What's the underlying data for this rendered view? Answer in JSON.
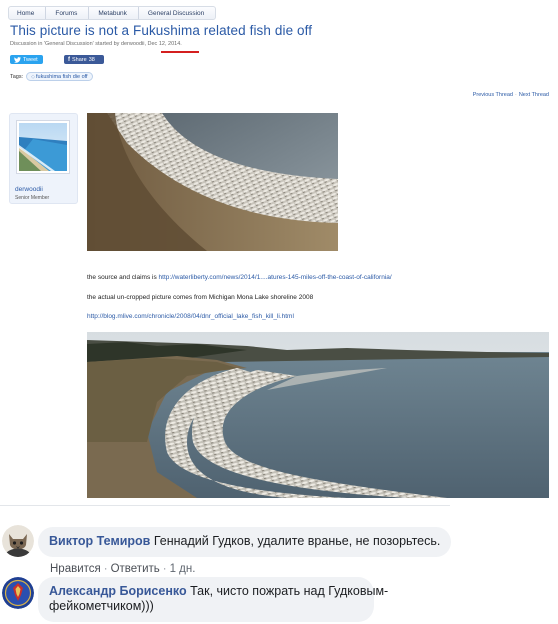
{
  "breadcrumb": [
    "Home",
    "Forums",
    "Metabunk",
    "General Discussion"
  ],
  "thread": {
    "title": "This picture is not a Fukushima related fish die off",
    "meta_prefix": "Discussion in 'General Discussion' started by derwoodii,",
    "date": "Dec 12, 2014."
  },
  "share": {
    "tweet_label": "Tweet",
    "facebook_label": "Share",
    "facebook_count": "38"
  },
  "tags": {
    "label": "Tags:",
    "items": [
      "fukushima fish die off"
    ]
  },
  "thread_nav": {
    "previous": "Previous Thread",
    "separator": "·",
    "next": "Next Thread"
  },
  "post": {
    "author": "derwoodii",
    "author_title": "Senior Member",
    "line1_text": "the source and claims is ",
    "line1_link": "http://waterliberty.com/news/2014/1....atures-145-miles-off-the-coast-of-california/",
    "line2_text": "the actual un-cropped picture comes from Michigan Mona Lake shoreline 2008",
    "line3_link": "http://blog.mlive.com/chronicle/2008/04/dnr_official_lake_fish_kill_li.html"
  },
  "comments": [
    {
      "author": "Виктор Темиров",
      "text": "Геннадий Гудков, удалите враньe, не позорьтесь.",
      "actions": [
        "Нравится",
        "Ответить",
        "1 дн."
      ]
    },
    {
      "author": "Александр Борисенко",
      "text_line1": "Так, чисто пожрать над Гудковым-",
      "text_line2": "фейкометчиком)))"
    }
  ],
  "colors": {
    "forum_link": "#2b5aa6",
    "highlight_underline": "#d41f1f",
    "twitter": "#2aa3ef",
    "facebook": "#3b5998",
    "fb_author": "#385898",
    "fb_bubble": "#f0f2f5"
  },
  "icons": [
    "twitter-bird-icon",
    "facebook-f-icon",
    "tag-icon"
  ]
}
